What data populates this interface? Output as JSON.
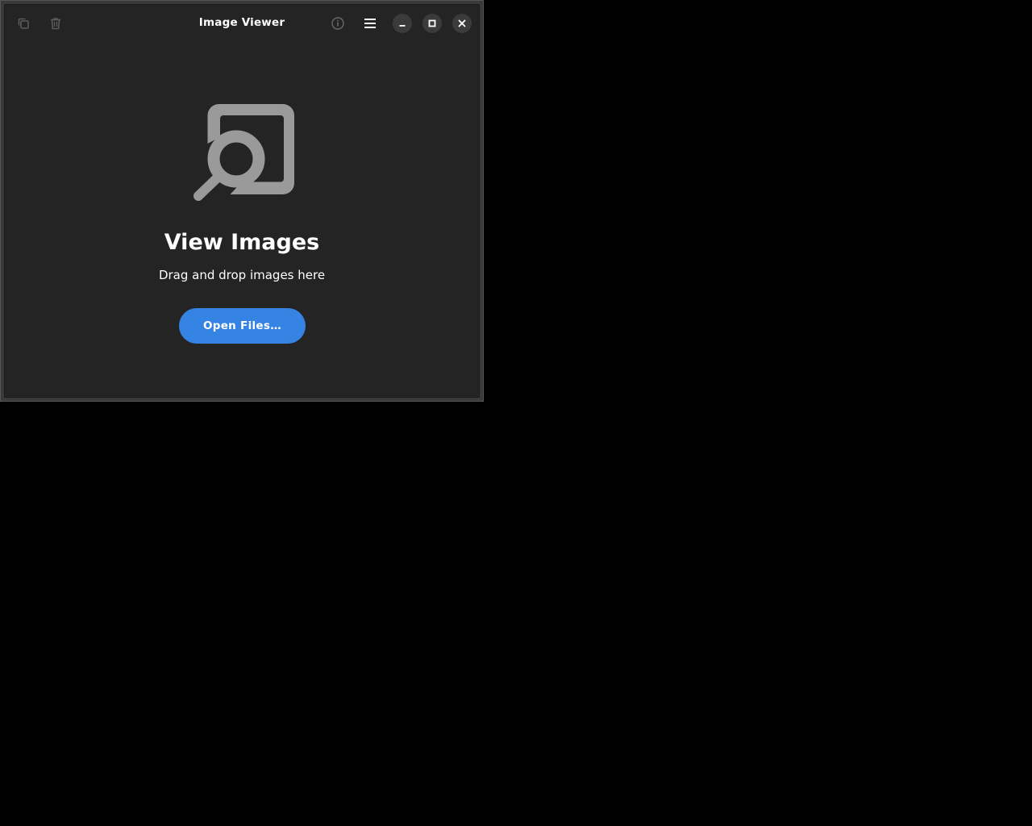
{
  "window": {
    "title": "Image Viewer"
  },
  "headerbar": {
    "left_icons": [
      "copy-icon",
      "trash-icon"
    ],
    "right_icons": [
      "info-icon",
      "hamburger-menu-icon"
    ],
    "window_controls": [
      "minimize-icon",
      "maximize-icon",
      "close-icon"
    ]
  },
  "status": {
    "icon": "image-viewer-search-icon",
    "title": "View Images",
    "description": "Drag and drop images here"
  },
  "actions": {
    "open_files_label": "Open Files…"
  },
  "colors": {
    "accent": "#3584e4",
    "window_bg": "#242424",
    "icon_gray": "#9a9a9a"
  }
}
